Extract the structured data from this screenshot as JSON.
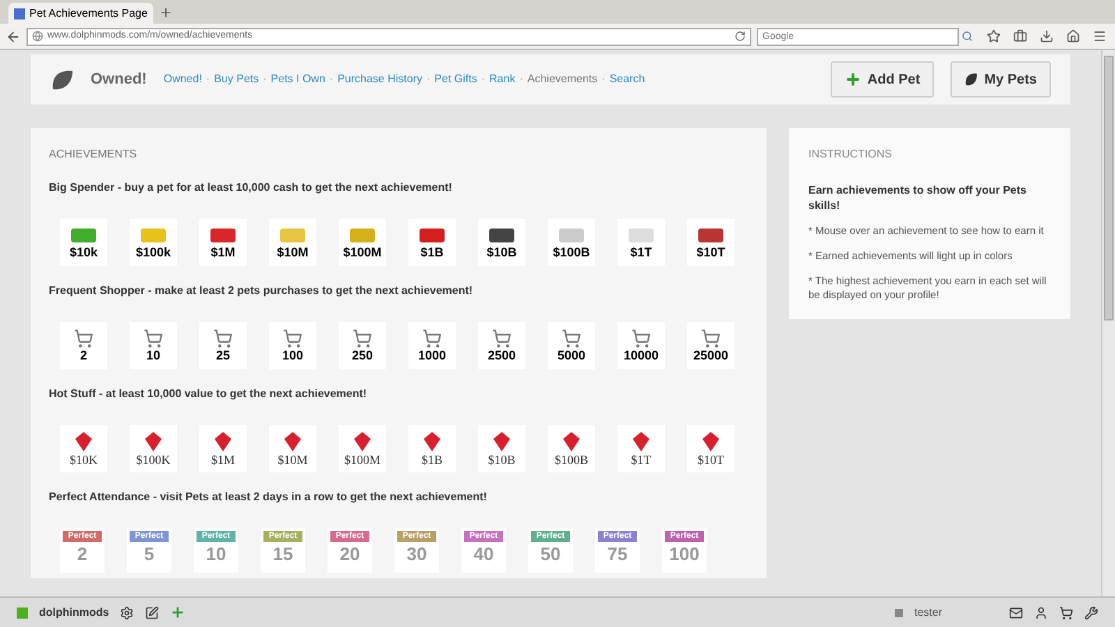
{
  "browser": {
    "tab_title": "Pet Achievements Page",
    "url": "www.dolphinmods.com/m/owned/achievements",
    "search_placeholder": "Google"
  },
  "header": {
    "brand": "Owned!",
    "separator": "·",
    "nav": [
      {
        "label": "Owned!",
        "selected": false
      },
      {
        "label": "Buy Pets",
        "selected": false
      },
      {
        "label": "Pets I Own",
        "selected": false
      },
      {
        "label": "Purchase History",
        "selected": false
      },
      {
        "label": "Pet Gifts",
        "selected": false
      },
      {
        "label": "Rank",
        "selected": false
      },
      {
        "label": "Achievements",
        "selected": true
      },
      {
        "label": "Search",
        "selected": false
      }
    ],
    "buttons": [
      {
        "label": "Add Pet",
        "kind": "add"
      },
      {
        "label": "My Pets",
        "kind": "pets"
      }
    ]
  },
  "achievements": {
    "title": "ACHIEVEMENTS",
    "sets": [
      {
        "description": "Big Spender - buy a pet for at least 10,000 cash to get the next achievement!",
        "kind": "cash",
        "badges": [
          "$10k",
          "$100k",
          "$1M",
          "$10M",
          "$100M",
          "$1B",
          "$10B",
          "$100B",
          "$1T",
          "$10T"
        ]
      },
      {
        "description": "Frequent Shopper - make at least 2 pets purchases to get the next achievement!",
        "kind": "cart",
        "badges": [
          "2",
          "10",
          "25",
          "100",
          "250",
          "1000",
          "2500",
          "5000",
          "10000",
          "25000"
        ]
      },
      {
        "description": "Hot Stuff - at least 10,000 value to get the next achievement!",
        "kind": "gem",
        "badges": [
          "$10K",
          "$100K",
          "$1M",
          "$10M",
          "$100M",
          "$1B",
          "$10B",
          "$100B",
          "$1T",
          "$10T"
        ]
      },
      {
        "description": "Perfect Attendance - visit Pets at least 2 days in a row to get the next achievement!",
        "kind": "calendar",
        "badges": [
          "Perfect",
          "Perfect",
          "Perfect",
          "Perfect",
          "Perfect",
          "Perfect",
          "Perfect",
          "Perfect",
          "Perfect",
          "Perfect"
        ],
        "numbers": [
          "2",
          "5",
          "10",
          "15",
          "20",
          "30",
          "40",
          "50",
          "75",
          "100"
        ]
      }
    ]
  },
  "instructions": {
    "title": "INSTRUCTIONS",
    "lead": "Earn achievements to show off your Pets skills!",
    "notes": [
      "* Mouse over an achievement to see how to earn it",
      "* Earned achievements will light up in colors",
      "* The highest achievement you earn in each set will be displayed on your profile!"
    ]
  },
  "bottom_bar": {
    "site": "dolphinmods",
    "user": "tester"
  }
}
